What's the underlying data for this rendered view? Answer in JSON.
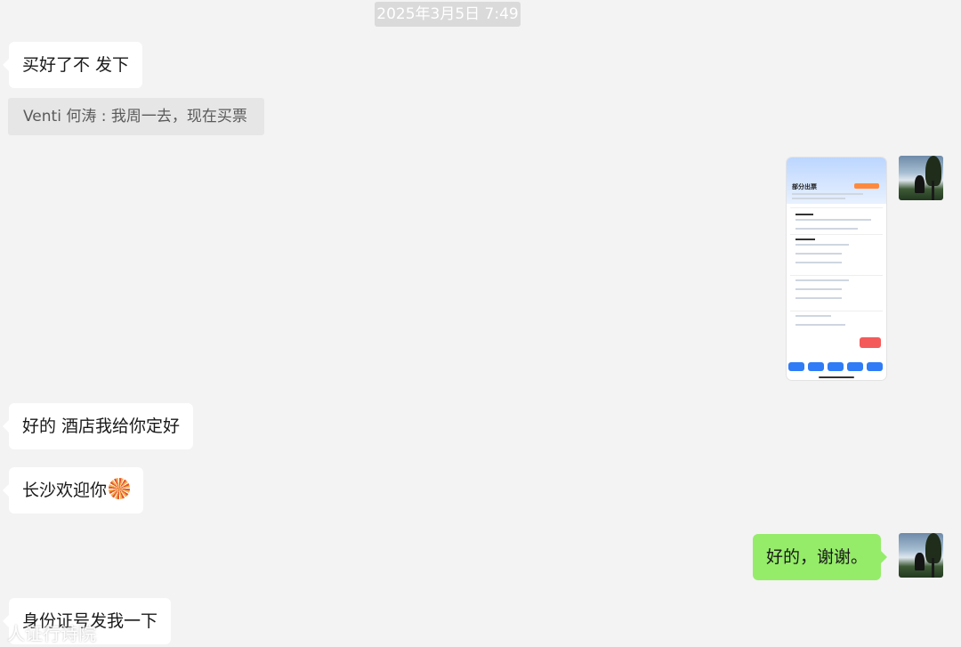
{
  "chat": {
    "timestamp": "2025年3月5日 7:49",
    "messages": [
      {
        "side": "left",
        "text": "买好了不 发下"
      },
      {
        "side": "left",
        "quote": "Venti 何涛 : 我周一去，现在买票"
      },
      {
        "side": "right",
        "type": "image",
        "desc_title": "部分出票"
      },
      {
        "side": "left",
        "text": "好的 酒店我给你定好"
      },
      {
        "side": "left",
        "text": "长沙欢迎你",
        "emoji": "fireworks-emoji"
      },
      {
        "side": "right",
        "text": "好的，谢谢。"
      },
      {
        "side": "left",
        "text": "身份证号发我一下"
      }
    ]
  },
  "watermark": "人证行诗院",
  "colors": {
    "background": "#f3f3f3",
    "bubble_left": "#ffffff",
    "bubble_right": "#95ec69",
    "timestamp_bg": "#dadada"
  }
}
